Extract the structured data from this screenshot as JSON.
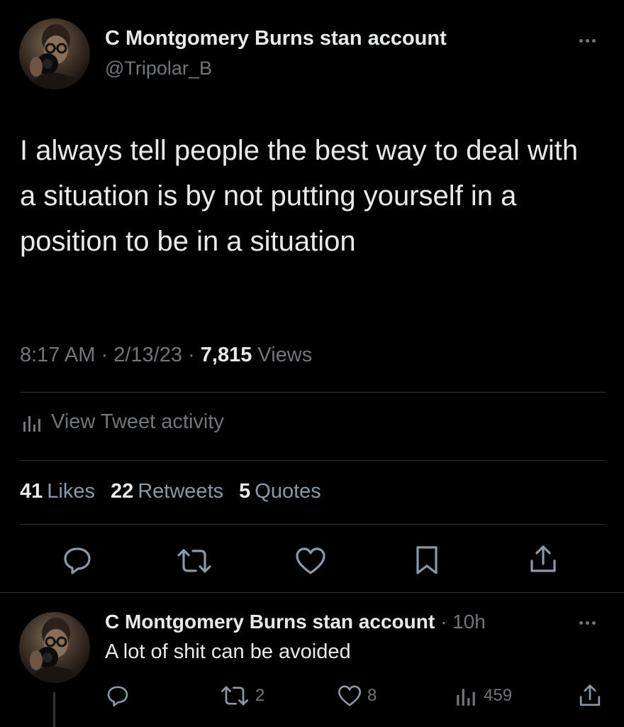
{
  "tweet": {
    "display_name": "C Montgomery Burns stan account",
    "handle": "@Tripolar_B",
    "text": "I always tell people the best way to deal with a situation is by not putting yourself in a position to be in a situation",
    "time": "8:17 AM",
    "sep1": "·",
    "date": "2/13/23",
    "sep2": "·",
    "views_count": "7,815",
    "views_label": "Views",
    "activity_label": "View Tweet activity",
    "stats": {
      "likes_count": "41",
      "likes_label": "Likes",
      "retweets_count": "22",
      "retweets_label": "Retweets",
      "quotes_count": "5",
      "quotes_label": "Quotes"
    },
    "actions": [
      "reply-icon",
      "retweet-icon",
      "like-icon",
      "bookmark-icon",
      "share-icon"
    ]
  },
  "reply": {
    "display_name": "C Montgomery Burns stan account",
    "sep": "·",
    "time": "10h",
    "text": "A lot of shit can be avoided",
    "retweet_count": "2",
    "like_count": "8",
    "views_count": "459"
  },
  "colors": {
    "background": "#000000",
    "text": "#e7e9ea",
    "muted": "#71767b",
    "divider": "#2f3336"
  }
}
